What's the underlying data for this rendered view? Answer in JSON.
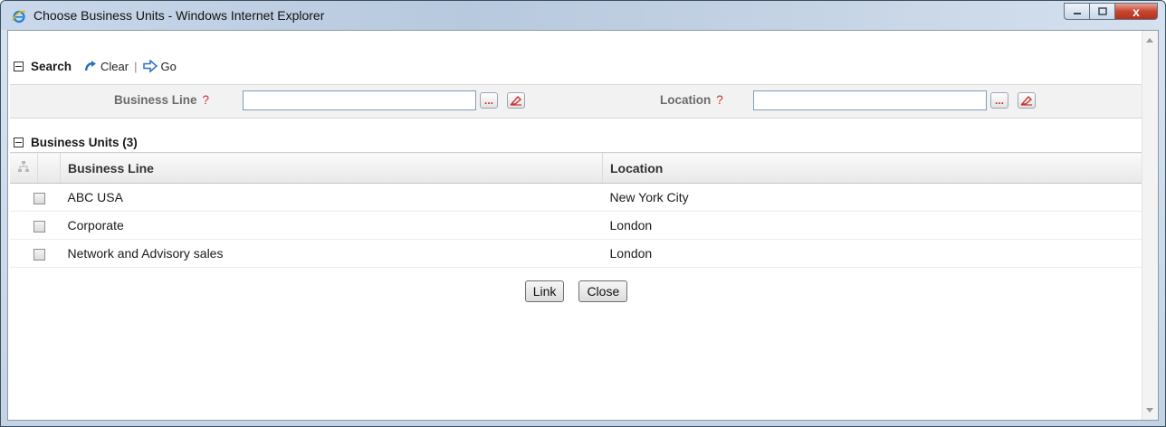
{
  "window": {
    "title": "Choose Business Units - Windows Internet Explorer",
    "close_glyph": "x"
  },
  "search": {
    "title": "Search",
    "clear_label": "Clear",
    "separator": "|",
    "go_label": "Go",
    "business_line_label": "Business Line",
    "location_label": "Location",
    "help_mark": "?",
    "business_line_value": "",
    "location_value": "",
    "browse_glyph": "..."
  },
  "business_units": {
    "title": "Business Units (3)",
    "columns": [
      "Business Line",
      "Location"
    ],
    "rows": [
      {
        "business_line": "ABC USA",
        "location": "New York City",
        "checked": false
      },
      {
        "business_line": "Corporate",
        "location": "London",
        "checked": false
      },
      {
        "business_line": "Network and Advisory sales",
        "location": "London",
        "checked": false
      }
    ]
  },
  "actions": {
    "link_label": "Link",
    "close_label": "Close"
  },
  "icons": [
    "ie-icon",
    "minimize-icon",
    "maximize-icon",
    "close-icon",
    "collapse-icon",
    "clear-icon",
    "go-arrow-icon",
    "browse-icon",
    "eraser-icon",
    "hierarchy-icon",
    "scroll-up-icon",
    "scroll-down-icon"
  ],
  "colors": {
    "title_bar": "#c4d3e4",
    "close_button": "#c8452f",
    "help_mark": "#cc3333",
    "label_gray": "#6b6b6b"
  }
}
